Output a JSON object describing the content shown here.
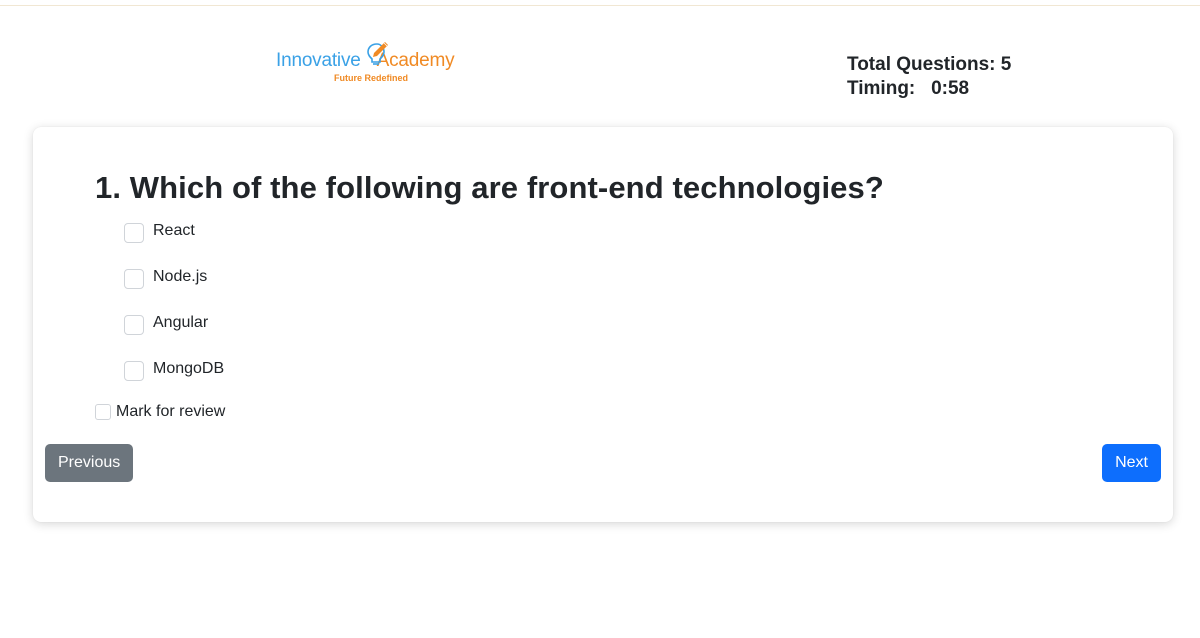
{
  "logo": {
    "word1": "Innovative",
    "word2": "Academy",
    "tagline": "Future Redefined",
    "icon": "lightbulb-pencil-icon",
    "colors": {
      "blue": "#3aa1e6",
      "orange": "#f08a24"
    }
  },
  "stats": {
    "total_questions_label": "Total Questions: 5",
    "timing_label": "Timing:   0:58"
  },
  "question": {
    "text": "1. Which of the following are front-end technologies?",
    "options": [
      {
        "label": "React",
        "checked": false
      },
      {
        "label": "Node.js",
        "checked": false
      },
      {
        "label": "Angular",
        "checked": false
      },
      {
        "label": "MongoDB",
        "checked": false
      }
    ]
  },
  "review": {
    "label": "Mark for review",
    "checked": false
  },
  "buttons": {
    "previous": "Previous",
    "next": "Next",
    "colors": {
      "previous": "#6c757d",
      "next": "#0d6efd"
    }
  }
}
